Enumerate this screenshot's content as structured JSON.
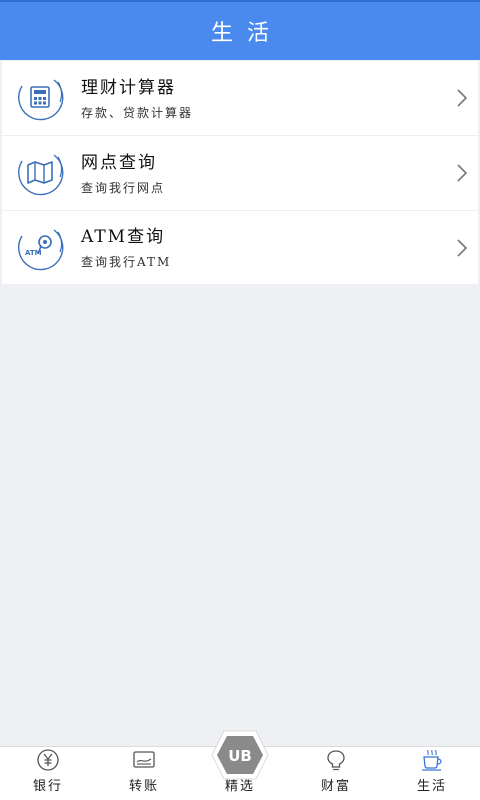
{
  "header": {
    "title": "生活"
  },
  "items": [
    {
      "title": "理财计算器",
      "subtitle": "存款、贷款计算器",
      "icon": "calculator-icon"
    },
    {
      "title": "网点查询",
      "subtitle": "查询我行网点",
      "icon": "map-icon"
    },
    {
      "title": "ATM查询",
      "subtitle": "查询我行ATM",
      "icon": "atm-location-icon",
      "icon_text": "ATM"
    }
  ],
  "tabbar": {
    "tabs": [
      {
        "label": "银行",
        "icon": "yuan-icon"
      },
      {
        "label": "转账",
        "icon": "transfer-icon"
      },
      {
        "label": "精选",
        "icon": "ub-logo-icon",
        "badge_text": "UB"
      },
      {
        "label": "财富",
        "icon": "lightbulb-icon"
      },
      {
        "label": "生活",
        "icon": "coffee-cup-icon",
        "active": true
      }
    ]
  },
  "colors": {
    "header": "#4a89ee",
    "background": "#eef0f4",
    "icon_stroke": "#3a6fb8",
    "active_tab": "#3a73d6"
  }
}
